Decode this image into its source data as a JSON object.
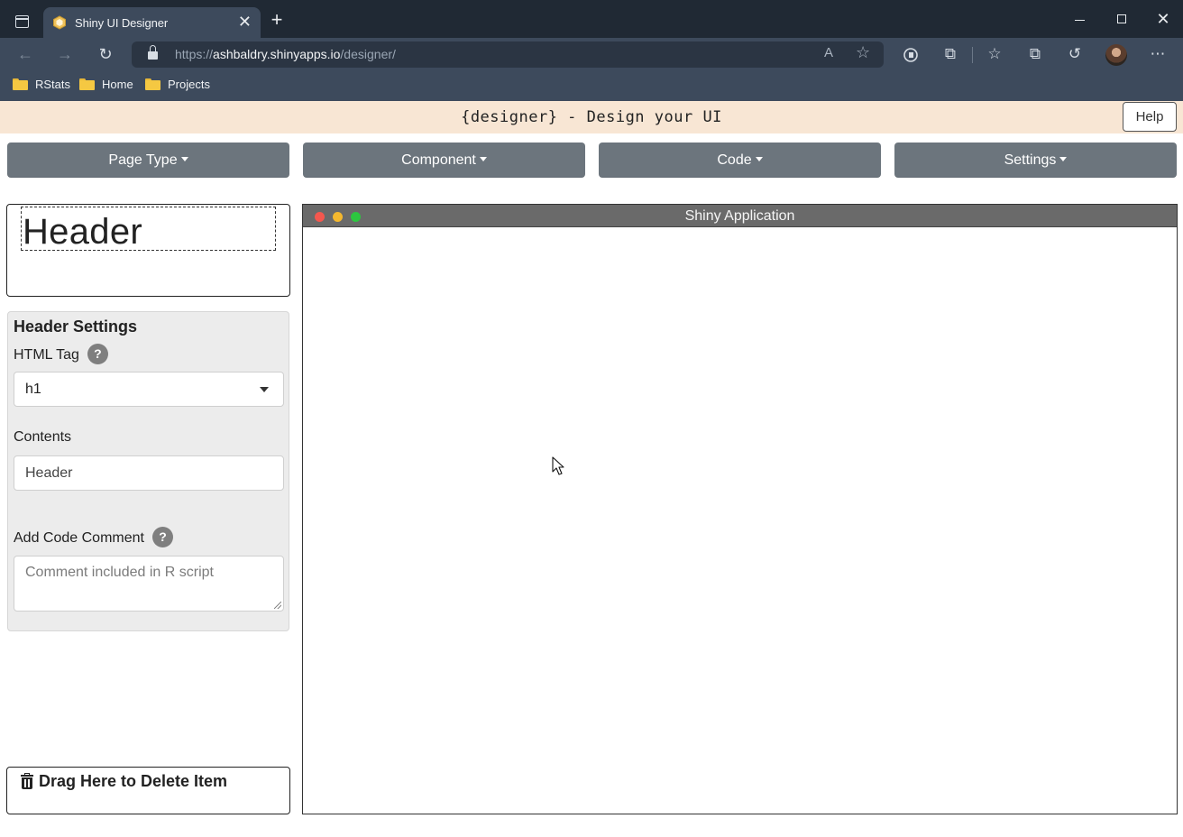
{
  "browser": {
    "tab_title": "Shiny UI Designer",
    "tab_close": "✕",
    "new_tab": "+",
    "url_scheme": "https://",
    "url_host": "ashbaldry.shinyapps.io",
    "url_path": "/designer/",
    "bookmarks": [
      {
        "label": "RStats"
      },
      {
        "label": "Home"
      },
      {
        "label": "Projects"
      }
    ],
    "icons": {
      "back": "←",
      "forward": "→",
      "refresh": "↻",
      "read_aloud": "A",
      "favorite_add": "☆",
      "extensions": "⧉",
      "favorites": "☆",
      "collections": "⧉",
      "history": "↺",
      "more": "⋯",
      "minimize": "",
      "close": "✕"
    }
  },
  "app": {
    "title": "{designer} - Design your UI",
    "help_label": "Help",
    "menus": [
      {
        "label": "Page Type"
      },
      {
        "label": "Component"
      },
      {
        "label": "Code"
      },
      {
        "label": "Settings"
      }
    ],
    "preview": {
      "header_text": "Header"
    },
    "settings": {
      "title": "Header Settings",
      "html_tag_label": "HTML Tag",
      "html_tag_value": "h1",
      "contents_label": "Contents",
      "contents_value": "Header",
      "comment_label": "Add Code Comment",
      "comment_placeholder": "Comment included in R script",
      "help_glyph": "?"
    },
    "delete_zone_label": "Drag Here to Delete Item",
    "app_window_title": "Shiny Application",
    "colors": {
      "title_bar_bg": "#f8e6d4",
      "menu_button_bg": "#6c757d",
      "window_dot_red": "#f4574e",
      "window_dot_yellow": "#f5b82e",
      "window_dot_green": "#2dc640"
    }
  }
}
